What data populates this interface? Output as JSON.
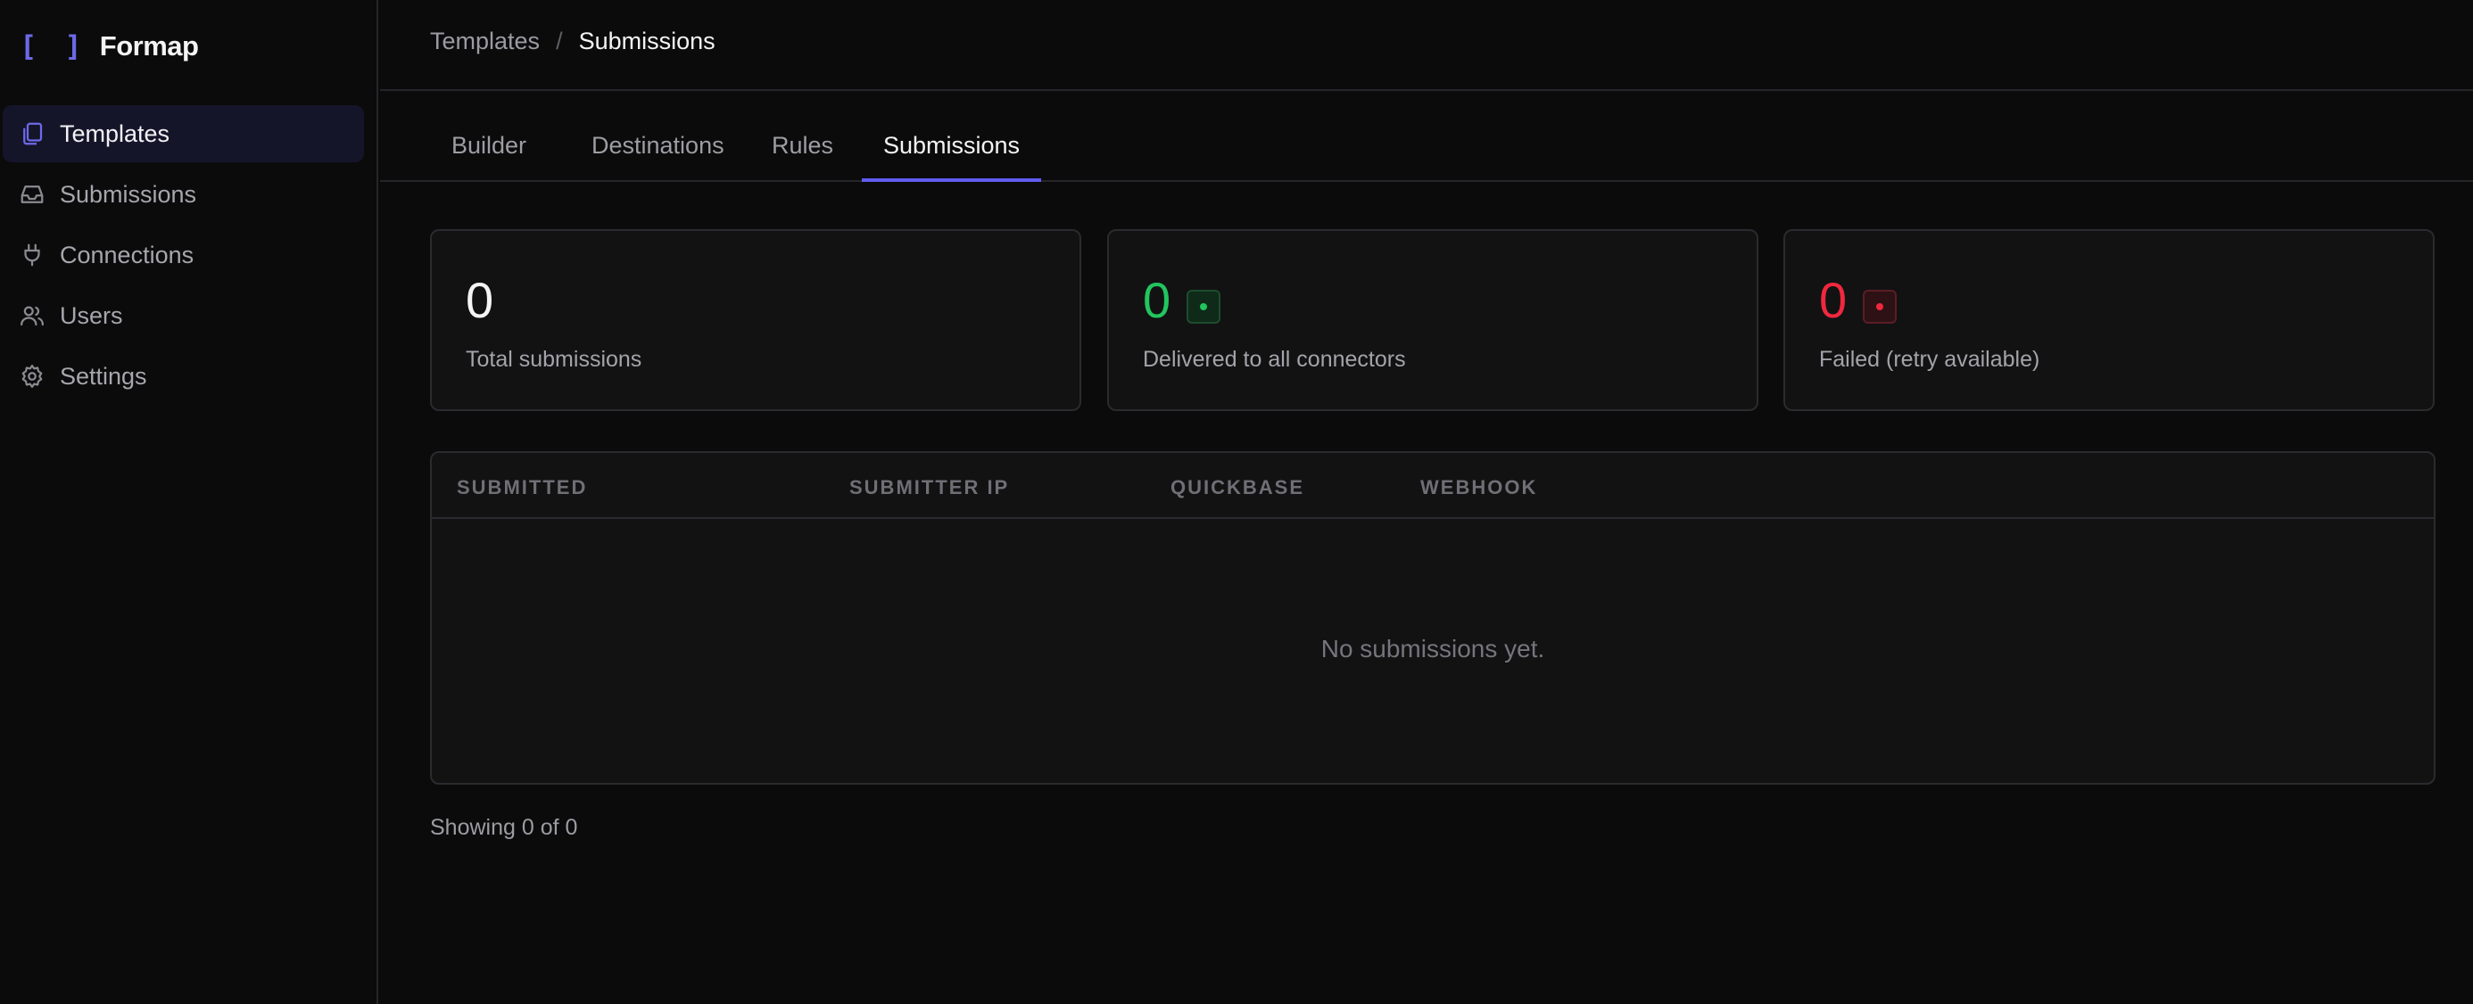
{
  "app": {
    "brand_icon": "[ ]",
    "brand_name": "Formap",
    "accent": "#5f5cf0"
  },
  "sidebar": {
    "items": [
      {
        "label": "Templates",
        "icon": "copy-icon",
        "active": true
      },
      {
        "label": "Submissions",
        "icon": "inbox-icon",
        "active": false
      },
      {
        "label": "Connections",
        "icon": "plug-icon",
        "active": false
      },
      {
        "label": "Users",
        "icon": "users-icon",
        "active": false
      },
      {
        "label": "Settings",
        "icon": "gear-icon",
        "active": false
      }
    ]
  },
  "breadcrumb": {
    "parent": "Templates",
    "separator": "/",
    "current": "Submissions"
  },
  "tabs": [
    {
      "label": "Builder",
      "active": false
    },
    {
      "label": "Destinations",
      "active": false
    },
    {
      "label": "Rules",
      "active": false
    },
    {
      "label": "Submissions",
      "active": true
    }
  ],
  "stats": [
    {
      "value": "0",
      "label": "Total submissions",
      "color": "#f4f4f5"
    },
    {
      "value": "0",
      "label": "Delivered to all connectors",
      "color": "#22c55e",
      "badge": "green-dot-icon"
    },
    {
      "value": "0",
      "label": "Failed (retry available)",
      "color": "#f0283e",
      "badge": "red-dot-icon"
    }
  ],
  "table": {
    "columns": [
      "SUBMITTED",
      "SUBMITTER IP",
      "QUICKBASE",
      "WEBHOOK"
    ],
    "rows": [],
    "empty_message": "No submissions yet."
  },
  "footer": {
    "count_text": "Showing 0 of 0"
  }
}
